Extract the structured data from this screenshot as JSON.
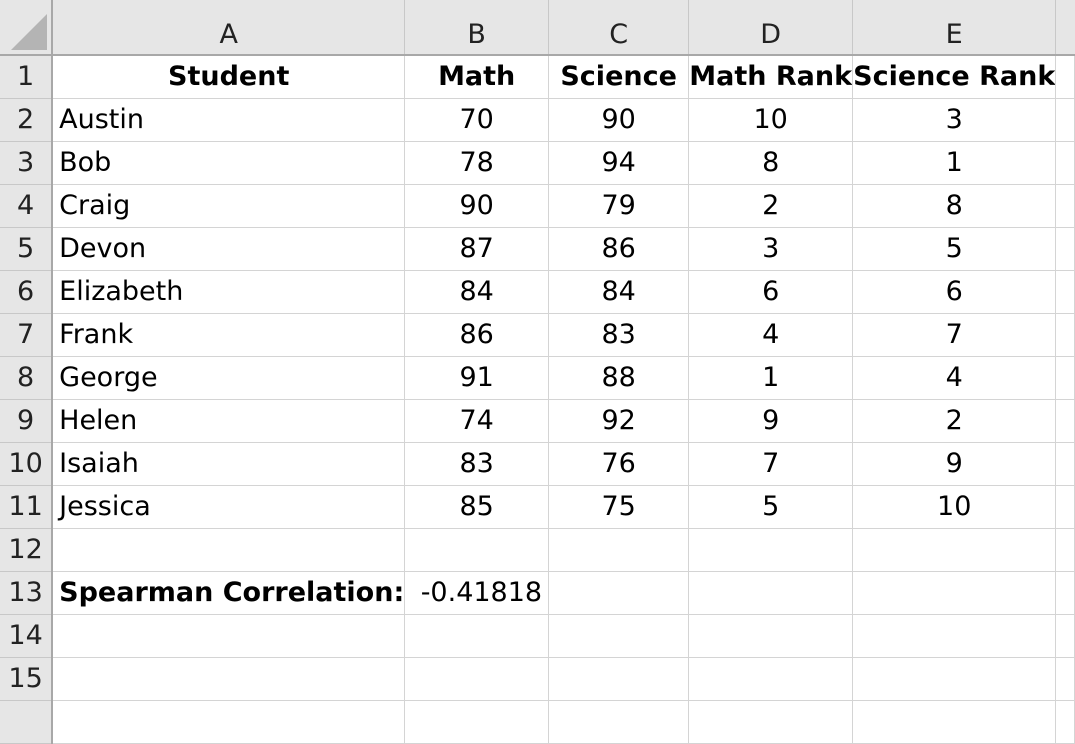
{
  "columns": [
    "A",
    "B",
    "C",
    "D",
    "E",
    ""
  ],
  "row_numbers": [
    "1",
    "2",
    "3",
    "4",
    "5",
    "6",
    "7",
    "8",
    "9",
    "10",
    "11",
    "12",
    "13",
    "14",
    "15"
  ],
  "header": {
    "student": "Student",
    "math": "Math",
    "science": "Science",
    "math_rank": "Math Rank",
    "science_rank": "Science Rank"
  },
  "rows": [
    {
      "student": "Austin",
      "math": "70",
      "science": "90",
      "math_rank": "10",
      "science_rank": "3"
    },
    {
      "student": "Bob",
      "math": "78",
      "science": "94",
      "math_rank": "8",
      "science_rank": "1"
    },
    {
      "student": "Craig",
      "math": "90",
      "science": "79",
      "math_rank": "2",
      "science_rank": "8"
    },
    {
      "student": "Devon",
      "math": "87",
      "science": "86",
      "math_rank": "3",
      "science_rank": "5"
    },
    {
      "student": "Elizabeth",
      "math": "84",
      "science": "84",
      "math_rank": "6",
      "science_rank": "6"
    },
    {
      "student": "Frank",
      "math": "86",
      "science": "83",
      "math_rank": "4",
      "science_rank": "7"
    },
    {
      "student": "George",
      "math": "91",
      "science": "88",
      "math_rank": "1",
      "science_rank": "4"
    },
    {
      "student": "Helen",
      "math": "74",
      "science": "92",
      "math_rank": "9",
      "science_rank": "2"
    },
    {
      "student": "Isaiah",
      "math": "83",
      "science": "76",
      "math_rank": "7",
      "science_rank": "9"
    },
    {
      "student": "Jessica",
      "math": "85",
      "science": "75",
      "math_rank": "5",
      "science_rank": "10"
    }
  ],
  "summary": {
    "label": "Spearman Correlation:",
    "value": "-0.41818"
  }
}
